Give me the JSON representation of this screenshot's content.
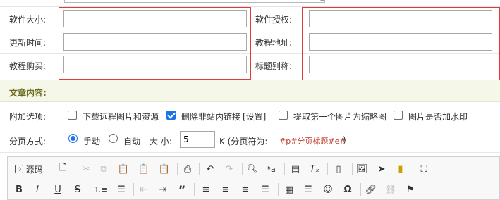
{
  "form": {
    "software_size_label": "软件大小:",
    "software_auth_label": "软件授权:",
    "update_time_label": "更新时间:",
    "tutorial_address_label": "教程地址:",
    "tutorial_buy_label": "教程购买:",
    "title_alias_label": "标题别称:",
    "software_size_value": "",
    "software_auth_value": "",
    "update_time_value": "",
    "tutorial_address_value": "",
    "tutorial_buy_value": "",
    "title_alias_value": ""
  },
  "section": {
    "title": "文章内容:"
  },
  "options": {
    "label": "附加选项:",
    "items": [
      {
        "label": "下载远程图片和资源",
        "checked": false
      },
      {
        "label": "删除非站内链接",
        "checked": true
      },
      {
        "label": "[设置]",
        "checked": null
      },
      {
        "label": "提取第一个图片为缩略图",
        "checked": false
      },
      {
        "label": "图片是否加水印",
        "checked": false
      }
    ]
  },
  "paging": {
    "label": "分页方式:",
    "manual_label": "手动",
    "auto_label": "自动",
    "size_label": "大 小:",
    "size_value": "5",
    "unit_label": "K (分页符为:",
    "separator_code": "#p#分页标题#e#",
    "close_paren": ")"
  },
  "toolbar": {
    "source_label": "源码",
    "colors": {
      "accent": "#1a73e8",
      "red_box": "#e03a3a",
      "section_bg": "#f5f7e8",
      "section_title": "#6b6b1f",
      "code_red": "#c0392b"
    }
  }
}
